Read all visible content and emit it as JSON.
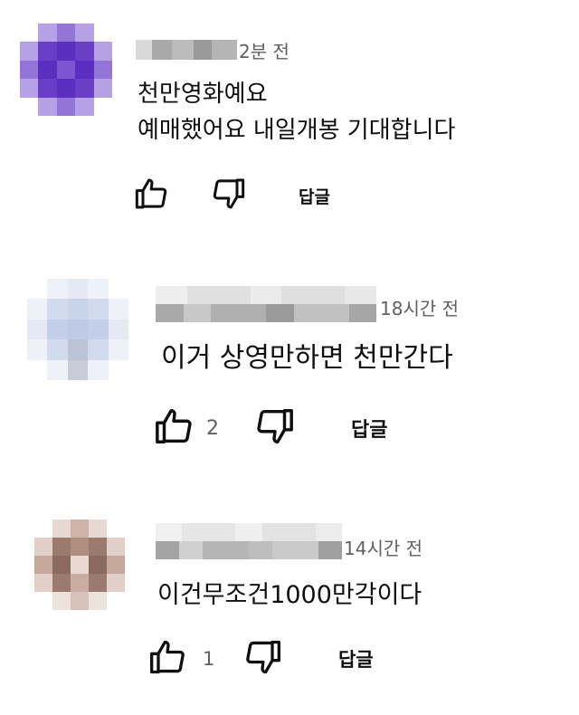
{
  "comments": [
    {
      "author_hidden": true,
      "time": "2분 전",
      "lines": [
        "천만영화예요",
        "예매했어요 내일개봉 기대합니다"
      ],
      "like_count": "",
      "reply_label": "답글",
      "avatar_color": "#6a3fc8"
    },
    {
      "author_hidden": true,
      "time": "18시간 전",
      "lines": [
        "이거 상영만하면 천만간다"
      ],
      "like_count": "2",
      "reply_label": "답글",
      "avatar_color": "#c8d4ea"
    },
    {
      "author_hidden": true,
      "time": "14시간 전",
      "lines": [
        "이건무조건1000만각이다"
      ],
      "like_count": "1",
      "reply_label": "답글",
      "avatar_color": "#9b7b6e"
    }
  ],
  "icons": {
    "like": "thumb-up-icon",
    "dislike": "thumb-down-icon"
  }
}
